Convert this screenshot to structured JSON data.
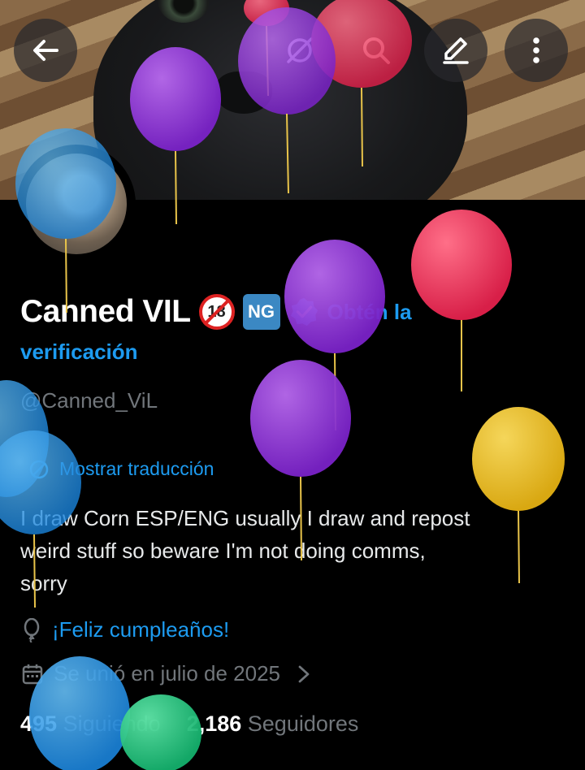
{
  "header": {
    "back_icon": "arrow-left-icon",
    "grok_icon": "grok-icon",
    "search_icon": "search-icon",
    "edit_icon": "edit-pencil-icon",
    "more_icon": "more-vertical-icon"
  },
  "profile": {
    "name": "Canned VIL",
    "badge_18": "18",
    "badge_ng": "NG",
    "verify_icon": "verified-badge-icon",
    "verify_link_part1": "Obtén la",
    "verify_link_part2": "verificación",
    "handle": "@Canned_ViL",
    "translate_label": "Mostrar traducción",
    "bio": "I draw Corn  ESP/ENG  usually I draw and repost\nweird stuff so beware   I'm not doing comms,\nsorry",
    "birthday_icon": "balloon-icon",
    "birthday": "¡Feliz cumpleaños!",
    "calendar_icon": "calendar-icon",
    "joined": "Se unió en julio de 2025",
    "chevron_icon": "chevron-right-icon",
    "following_count": "495",
    "following_label": "Siguiendo",
    "followers_count": "2,186",
    "followers_label": "Seguidores"
  },
  "colors": {
    "accent": "#1d9bf0",
    "muted": "#71767b",
    "background": "#000000",
    "balloon_purple": "#8a2fd6",
    "balloon_red": "#e8335a",
    "balloon_blue": "#1f8fe6",
    "balloon_yellow": "#e0b21a",
    "balloon_green": "#1fbf7a"
  }
}
